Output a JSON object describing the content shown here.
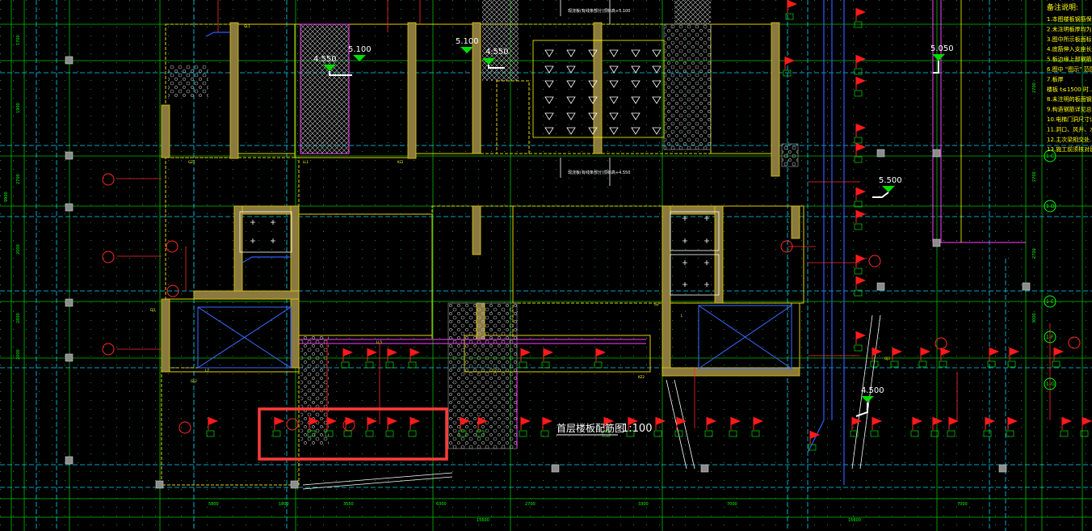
{
  "drawing": {
    "plan_title": "首层楼板配筋图",
    "plan_scale": "1:100",
    "elevations": [
      "4.550",
      "5.100",
      "5.100",
      "4.550",
      "5.050",
      "5.500",
      "4.500"
    ],
    "notes_title": "备注说明:",
    "notes": [
      "1.本图楼板钢筋保护层厚度详见总说明。",
      "2.未注明板厚均为120mm。",
      "3.图中所示板面标高见说明。",
      "4.底筋伸入支座长度详见图集。",
      "5.板边缘上部钢筋锚入梁内。",
      "6.图中 \"图示\" 范围为降板区域。",
      "7.板厚",
      "   楼板 t≤1500 时...",
      "8.未注明的板面钢筋详见说明。",
      "9.构造钢筋详见总说明。",
      "10.电梯门洞尺寸详见建施。",
      "11.洞口、风井、水井详见设备图。",
      "12.主次梁相交处...",
      "13.施工前须核对建施图。"
    ],
    "right_axes": [
      "1-C",
      "1-D",
      "1-E",
      "1-F",
      "1-G"
    ],
    "grid_top_labels": [
      "5300",
      "1300",
      "3300",
      "4300",
      "2700",
      "3100",
      "2700",
      "2700"
    ],
    "grid_bottom_labels": [
      "5800",
      "1800",
      "3550",
      "6300",
      "2700",
      "3300",
      "7000",
      "7000"
    ],
    "grid_total_labels": [
      "15600",
      "15600"
    ],
    "left_dims": [
      "1700",
      "1900",
      "2700",
      "9900",
      "2000",
      "2800",
      "2800",
      "2000"
    ],
    "right_dims": [
      "2700",
      "2700",
      "2700",
      "3000",
      "3000"
    ],
    "elev_annotation_1": "现浇板(有线条部分)顶标高+5.100",
    "elev_annotation_2": "现浇板(有线条部分)顶标高+4.550",
    "small_labels": [
      "GL1",
      "GZ1",
      "LL1",
      "KL2",
      "GJ1",
      "GL2",
      "LZ",
      "TZ",
      "LL5",
      "GZ",
      "KZ2",
      "L",
      "GJ3"
    ]
  },
  "colors": {
    "background": "#000000",
    "highlight_box": "#ff3b3b",
    "wall": "#d9d08a",
    "beam": "#ffff00",
    "grid_green": "#00ff00",
    "dash_cyan": "#00e0ff",
    "magenta": "#ff40ff",
    "blue": "#3a6bff",
    "red": "#ff2a2a",
    "white": "#ffffff"
  },
  "icons": {
    "section_flag": "flag-icon",
    "elevation_marker": "triangle-down-icon",
    "axis_bubble": "circle-axis-icon"
  },
  "highlight": {
    "label": ""
  }
}
